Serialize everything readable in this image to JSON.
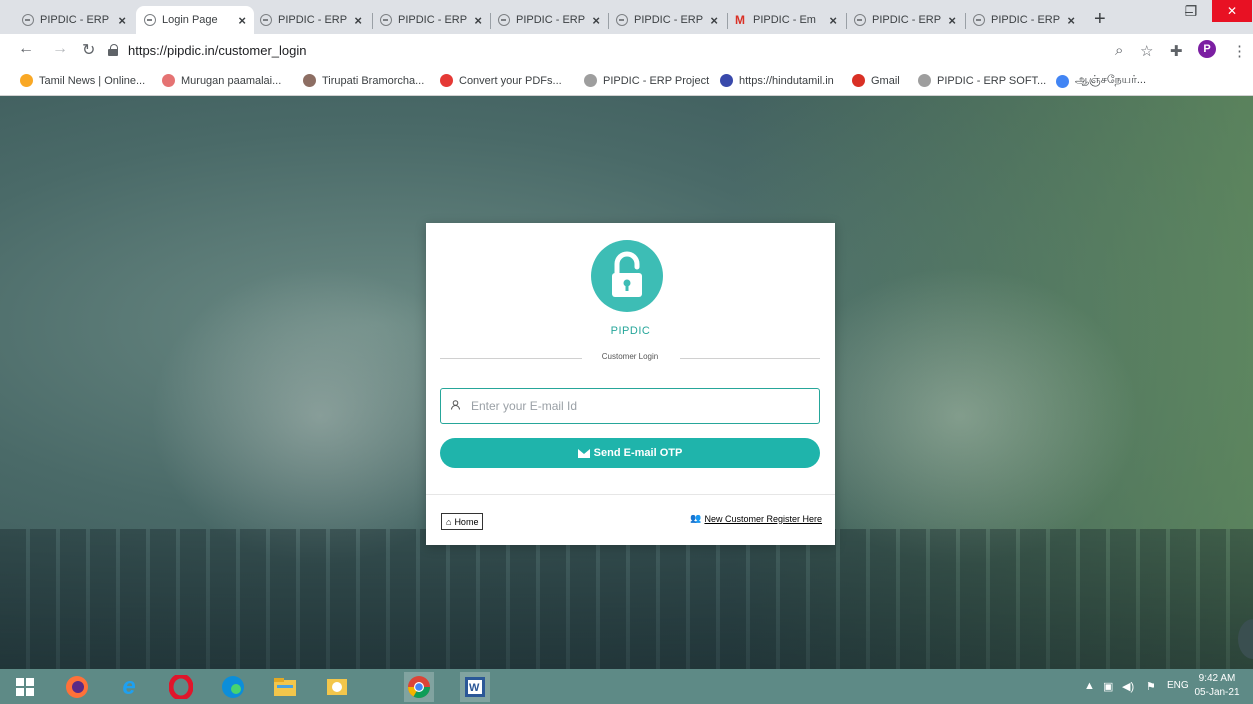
{
  "browser": {
    "tabs": [
      {
        "title": "PIPDIC - ERP",
        "active": false
      },
      {
        "title": "Login Page",
        "active": true
      },
      {
        "title": "PIPDIC - ERP",
        "active": false
      },
      {
        "title": "PIPDIC - ERP",
        "active": false
      },
      {
        "title": "PIPDIC - ERP",
        "active": false
      },
      {
        "title": "PIPDIC - ERP",
        "active": false
      },
      {
        "title": "PIPDIC - Em",
        "active": false
      },
      {
        "title": "PIPDIC - ERP",
        "active": false
      },
      {
        "title": "PIPDIC - ERP",
        "active": false
      }
    ],
    "url": "https://pipdic.in/customer_login",
    "profile_initial": "P",
    "bookmarks": [
      {
        "label": "Tamil News | Online...",
        "color": "#f9a825"
      },
      {
        "label": "Murugan paamalai...",
        "color": "#e57373"
      },
      {
        "label": "Tirupati Bramorcha...",
        "color": "#8d6e63"
      },
      {
        "label": "Convert your PDFs...",
        "color": "#e53935"
      },
      {
        "label": "PIPDIC - ERP Project",
        "color": "#9e9e9e"
      },
      {
        "label": "https://hindutamil.in",
        "color": "#3949ab"
      },
      {
        "label": "Gmail",
        "color": "#d93025"
      },
      {
        "label": "PIPDIC - ERP SOFT...",
        "color": "#9e9e9e"
      },
      {
        "label": "ஆஞ்சநேயர்...",
        "color": "#4285f4"
      }
    ]
  },
  "login": {
    "brand": "PIPDIC",
    "subtitle": "Customer Login",
    "email_placeholder": "Enter your E-mail Id",
    "email_value": "",
    "send_otp_label": "Send E-mail OTP",
    "home_label": "Home",
    "register_label": "New Customer Register Here",
    "accent_color": "#1fb4ab"
  },
  "taskbar": {
    "language": "ENG",
    "time": "9:42 AM",
    "date": "05-Jan-21"
  }
}
